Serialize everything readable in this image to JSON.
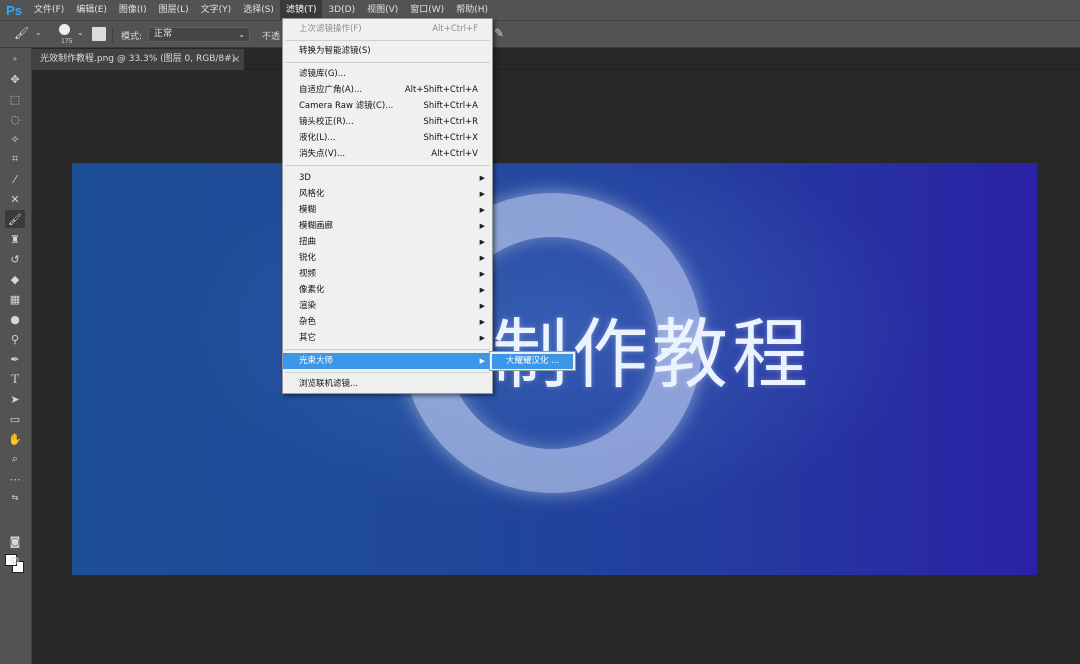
{
  "app": {
    "logo": "Ps"
  },
  "menubar": {
    "items": [
      "文件(F)",
      "编辑(E)",
      "图像(I)",
      "图层(L)",
      "文字(Y)",
      "选择(S)",
      "滤镜(T)",
      "3D(D)",
      "视图(V)",
      "窗口(W)",
      "帮助(H)"
    ],
    "active_index": 6
  },
  "options_bar": {
    "brush_size": "175",
    "mode_label": "模式:",
    "mode_value": "正常",
    "opacity_label": "不透"
  },
  "document_tab": {
    "title": "光效制作教程.png @ 33.3% (图层 0, RGB/8#)",
    "close": "×"
  },
  "canvas": {
    "title_text": "制作教程",
    "colors": {
      "left": "#1d4f97",
      "right": "#2a22a6"
    }
  },
  "filter_menu": {
    "last_filter": {
      "label": "上次滤镜操作(F)",
      "shortcut": "Alt+Ctrl+F"
    },
    "convert_smart": {
      "label": "转换为智能滤镜(S)"
    },
    "group1": [
      {
        "label": "滤镜库(G)...",
        "shortcut": ""
      },
      {
        "label": "自适应广角(A)...",
        "shortcut": "Alt+Shift+Ctrl+A"
      },
      {
        "label": "Camera Raw 滤镜(C)...",
        "shortcut": "Shift+Ctrl+A"
      },
      {
        "label": "镜头校正(R)...",
        "shortcut": "Shift+Ctrl+R"
      },
      {
        "label": "液化(L)...",
        "shortcut": "Shift+Ctrl+X"
      },
      {
        "label": "消失点(V)...",
        "shortcut": "Alt+Ctrl+V"
      }
    ],
    "group2": [
      "3D",
      "风格化",
      "模糊",
      "模糊画廊",
      "扭曲",
      "锐化",
      "视频",
      "像素化",
      "渲染",
      "杂色",
      "其它"
    ],
    "plugin": "光束大师",
    "browse": "浏览联机滤镜...",
    "submenu_item": "大耀耀汉化 ..."
  },
  "accent_color": "#3b97e8"
}
